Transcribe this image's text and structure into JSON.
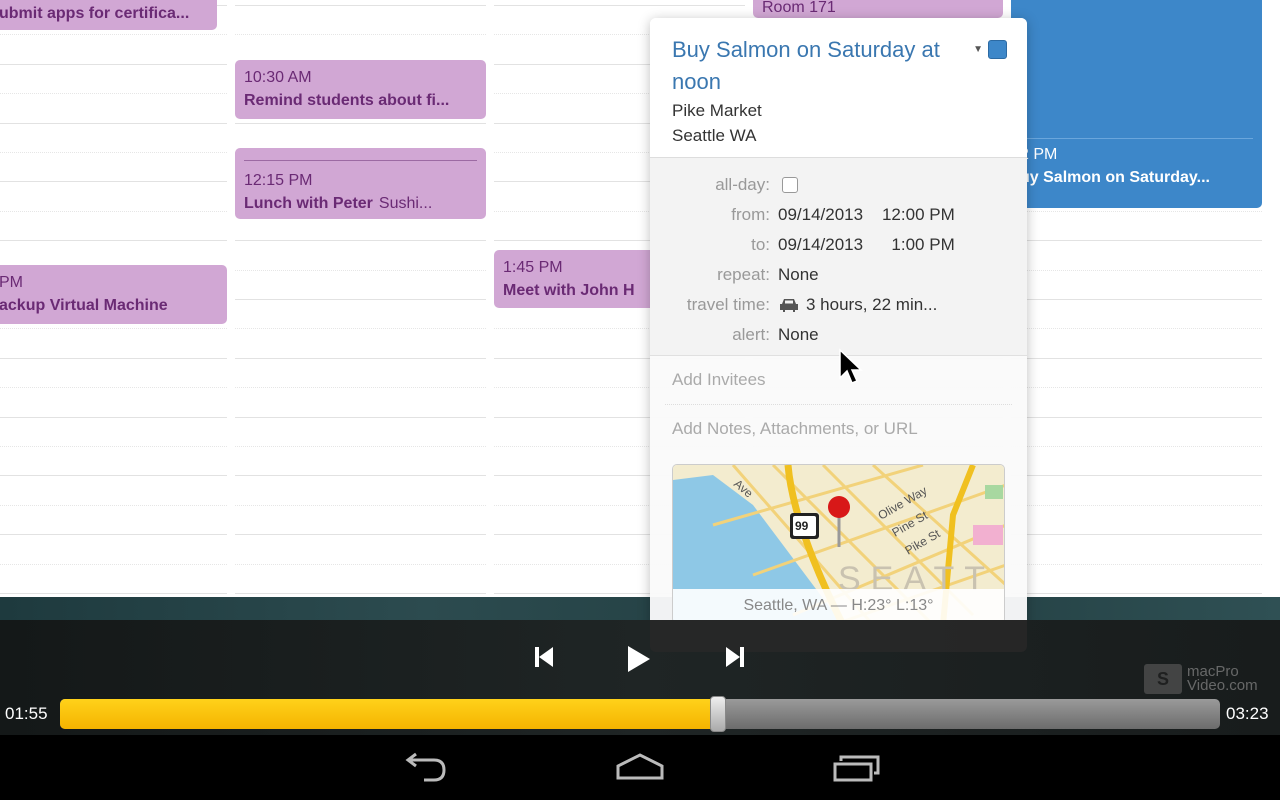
{
  "calendar": {
    "events": [
      {
        "name": "ubmit apps for certifica...",
        "time": ""
      },
      {
        "time": "10:30 AM",
        "name": "Remind students about fi..."
      },
      {
        "time": "12:15 PM",
        "name": "Lunch with Peter",
        "location": "Sushi..."
      },
      {
        "time": "PM",
        "name": "ackup Virtual Machine"
      },
      {
        "time": "1:45 PM",
        "name": "Meet with John H"
      },
      {
        "name": "Room 171"
      },
      {
        "time": "2 PM",
        "name": "uy Salmon on Saturday..."
      }
    ],
    "colors": {
      "event": "#d1a7d4",
      "selected": "#3d87c9"
    }
  },
  "popover": {
    "title": "Buy Salmon on Saturday at noon",
    "location_line1": "Pike Market",
    "location_line2": "Seattle WA",
    "calendar_color": "#3d87c9",
    "fields": {
      "allday_label": "all-day:",
      "allday_checked": false,
      "from_label": "from:",
      "from_value": "09/14/2013    12:00 PM",
      "to_label": "to:",
      "to_value": "09/14/2013      1:00 PM",
      "repeat_label": "repeat:",
      "repeat_value": "None",
      "travel_label": "travel time:",
      "travel_value": "3 hours, 22 min...",
      "alert_label": "alert:",
      "alert_value": "None"
    },
    "add_invitees": "Add Invitees",
    "add_notes": "Add Notes, Attachments, or URL",
    "map": {
      "labels": [
        "Olive Way",
        "Pine St",
        "Pike St",
        "Ave",
        "99",
        "SEATT"
      ],
      "caption": "Seattle, WA — H:23° L:13°"
    }
  },
  "player": {
    "elapsed": "01:55",
    "total": "03:23",
    "progress_percent": 56.7,
    "logo": "macPro Video.com",
    "accent": "#f5b400"
  }
}
